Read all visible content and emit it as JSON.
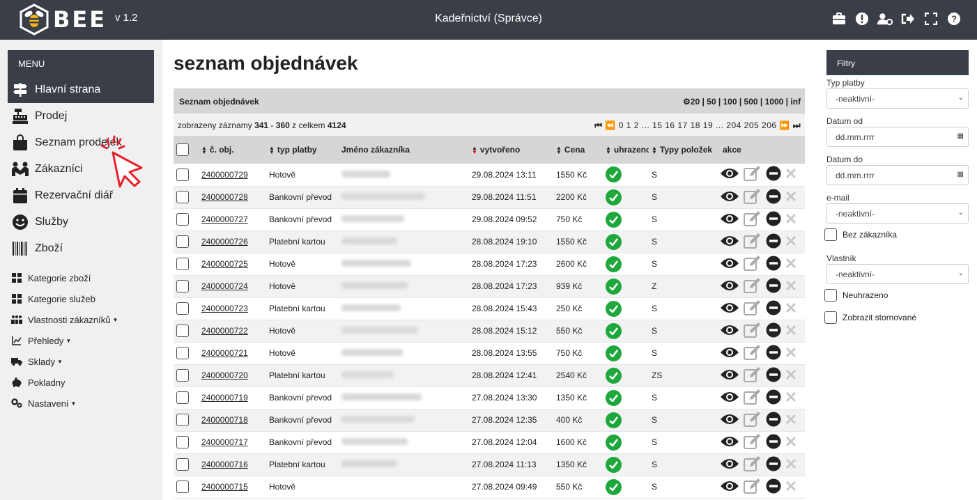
{
  "header": {
    "logo_text": "BEE",
    "version": "v 1.2",
    "title": "Kadeřnictví (Správce)",
    "icons": [
      "briefcase-icon",
      "info-icon",
      "user-settings-icon",
      "logout-icon",
      "fullscreen-icon",
      "help-icon"
    ]
  },
  "sidebar": {
    "menu_label": "MENU",
    "items": [
      {
        "label": "Hlavní strana",
        "icon": "signpost-icon"
      },
      {
        "label": "Prodej",
        "icon": "cash-register-icon"
      },
      {
        "label": "Seznam prodejek",
        "icon": "shopping-bag-icon"
      },
      {
        "label": "Zákazníci",
        "icon": "people-icon"
      },
      {
        "label": "Rezervační diář",
        "icon": "calendar-icon"
      },
      {
        "label": "Služby",
        "icon": "smile-icon"
      },
      {
        "label": "Zboží",
        "icon": "barcode-icon"
      }
    ],
    "subitems": [
      {
        "label": "Kategorie zboží",
        "icon": "grid-icon"
      },
      {
        "label": "Kategorie služeb",
        "icon": "grid-icon"
      },
      {
        "label": "Vlastnosti zákazníků",
        "icon": "users-icon",
        "dropdown": true
      },
      {
        "label": "Přehledy",
        "icon": "chart-icon",
        "dropdown": true
      },
      {
        "label": "Sklady",
        "icon": "truck-icon",
        "dropdown": true
      },
      {
        "label": "Pokladny",
        "icon": "piggy-bank-icon"
      },
      {
        "label": "Nastavení",
        "icon": "gears-icon",
        "dropdown": true
      }
    ]
  },
  "main": {
    "title": "seznam objednávek",
    "panel_title": "Seznam objednávek",
    "page_sizes": "20 | 50 | 100 | 500 | 1000 | inf",
    "records_prefix": "zobrazeny záznamy",
    "records_from": "341",
    "records_sep": "-",
    "records_to": "360",
    "records_mid": "z celkem",
    "records_total": "4124",
    "pager": "0 1 2 ... 15 16 17 18 19 ... 204 205 206",
    "columns": [
      "č. obj.",
      "typ platby",
      "Jméno zákazníka",
      "vytvořeno",
      "Cena",
      "uhrazeno",
      "Typy položek",
      "akce"
    ],
    "rows": [
      {
        "id": "2400000729",
        "payment": "Hotově",
        "created": "29.08.2024 13:11",
        "price": "1550 Kč",
        "types": "S"
      },
      {
        "id": "2400000728",
        "payment": "Bankovní převod",
        "created": "29.08.2024 11:51",
        "price": "2200 Kč",
        "types": "S"
      },
      {
        "id": "2400000727",
        "payment": "Bankovní převod",
        "created": "29.08.2024 09:52",
        "price": "750 Kč",
        "types": "S"
      },
      {
        "id": "2400000726",
        "payment": "Platební kartou",
        "created": "28.08.2024 19:10",
        "price": "1550 Kč",
        "types": "S"
      },
      {
        "id": "2400000725",
        "payment": "Hotově",
        "created": "28.08.2024 17:23",
        "price": "2600 Kč",
        "types": "S"
      },
      {
        "id": "2400000724",
        "payment": "Hotově",
        "created": "28.08.2024 17:23",
        "price": "939 Kč",
        "types": "Z"
      },
      {
        "id": "2400000723",
        "payment": "Platební kartou",
        "created": "28.08.2024 15:43",
        "price": "250 Kč",
        "types": "S"
      },
      {
        "id": "2400000722",
        "payment": "Hotově",
        "created": "28.08.2024 15:12",
        "price": "550 Kč",
        "types": "S"
      },
      {
        "id": "2400000721",
        "payment": "Hotově",
        "created": "28.08.2024 13:55",
        "price": "750 Kč",
        "types": "S"
      },
      {
        "id": "2400000720",
        "payment": "Platební kartou",
        "created": "28.08.2024 12:41",
        "price": "2540 Kč",
        "types": "ZS"
      },
      {
        "id": "2400000719",
        "payment": "Bankovní převod",
        "created": "27.08.2024 13:30",
        "price": "1350 Kč",
        "types": "S"
      },
      {
        "id": "2400000718",
        "payment": "Bankovní převod",
        "created": "27.08.2024 12:35",
        "price": "400 Kč",
        "types": "S"
      },
      {
        "id": "2400000717",
        "payment": "Bankovní převod",
        "created": "27.08.2024 12:04",
        "price": "1600 Kč",
        "types": "S"
      },
      {
        "id": "2400000716",
        "payment": "Platební kartou",
        "created": "27.08.2024 11:13",
        "price": "1350 Kč",
        "types": "S"
      },
      {
        "id": "2400000715",
        "payment": "Hotově",
        "created": "27.08.2024 09:49",
        "price": "550 Kč",
        "types": "S"
      }
    ]
  },
  "filters": {
    "title": "Filtry",
    "payment_label": "Typ platby",
    "payment_value": "-neaktivní-",
    "date_from_label": "Datum od",
    "date_from_placeholder": "dd.mm.rrrr",
    "date_to_label": "Datum do",
    "date_to_placeholder": "dd.mm.rrrr",
    "email_label": "e-mail",
    "email_value": "-neaktivní-",
    "no_customer_label": "Bez zákazníka",
    "owner_label": "Vlastník",
    "owner_value": "-neaktivní-",
    "unpaid_label": "Neuhrazeno",
    "cancelled_label": "Zobrazit stornované"
  },
  "colors": {
    "dark": "#3a3f47",
    "success": "#1ea83c",
    "cursor": "#e8202a"
  }
}
